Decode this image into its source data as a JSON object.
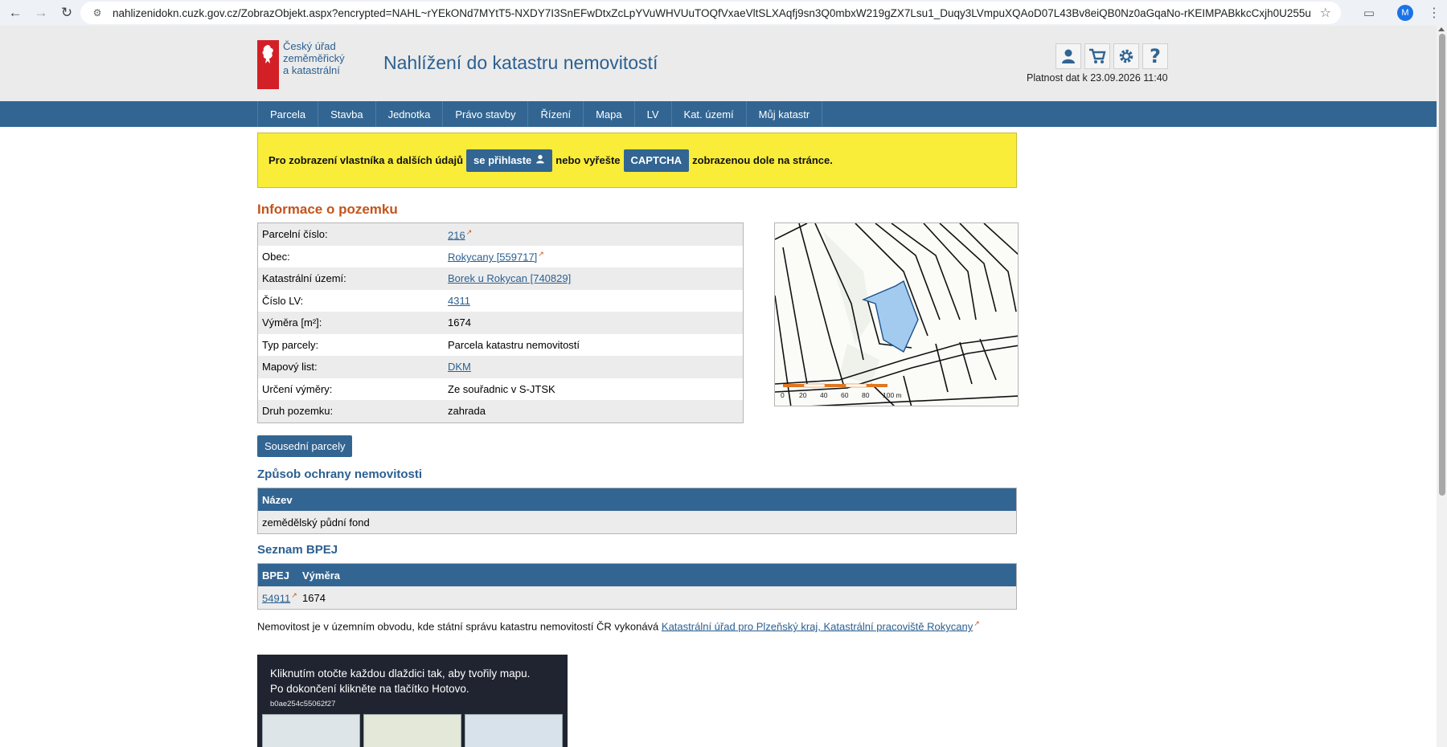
{
  "browser": {
    "url": "nahlizenidokn.cuzk.gov.cz/ZobrazObjekt.aspx?encrypted=NAHL~rYEkONd7MYtT5-NXDY7I3SnEFwDtxZcLpYVuWHVUuTOQfVxaeVltSLXAqfj9sn3Q0mbxW219gZX7Lsu1_Duqy3LVmpuXQAoD07L43Bv8eiQB0Nz0aGqaNo-rKEIMPABkkcCxjh0U255ugr2Bb4ZVx...",
    "profile_initial": "M"
  },
  "header": {
    "logo_lines": [
      "Český úřad",
      "zeměměřický",
      "a katastrální"
    ],
    "title": "Nahlížení do katastru nemovitostí",
    "validity": "Platnost dat k 23.09.2026 11:40"
  },
  "menu": [
    "Parcela",
    "Stavba",
    "Jednotka",
    "Právo stavby",
    "Řízení",
    "Mapa",
    "LV",
    "Kat. území",
    "Můj katastr"
  ],
  "notice": {
    "part1": "Pro zobrazení vlastníka a dalších údajů",
    "login_button": "se přihlaste",
    "part2": "nebo vyřešte",
    "captcha_button": "CAPTCHA",
    "part3": "zobrazenou dole na stránce."
  },
  "parcel": {
    "heading": "Informace o pozemku",
    "rows": [
      {
        "label": "Parcelní číslo:",
        "value": "216",
        "link": true,
        "ext": true
      },
      {
        "label": "Obec:",
        "value": "Rokycany [559717]",
        "link": true,
        "ext": true
      },
      {
        "label": "Katastrální území:",
        "value": "Borek u Rokycan [740829]",
        "link": true,
        "ext": false
      },
      {
        "label": "Číslo LV:",
        "value": "4311",
        "link": true,
        "ext": false
      },
      {
        "label": "Výměra [m²]:",
        "value": "1674",
        "link": false,
        "ext": false
      },
      {
        "label": "Typ parcely:",
        "value": "Parcela katastru nemovitostí",
        "link": false,
        "ext": false
      },
      {
        "label": "Mapový list:",
        "value": "DKM",
        "link": true,
        "ext": false
      },
      {
        "label": "Určení výměry:",
        "value": "Ze souřadnic v S-JTSK",
        "link": false,
        "ext": false
      },
      {
        "label": "Druh pozemku:",
        "value": "zahrada",
        "link": false,
        "ext": false
      }
    ],
    "neighbors_button": "Sousední parcely",
    "map_scale_labels": [
      "0",
      "20",
      "40",
      "60",
      "80",
      "100 m"
    ]
  },
  "protection": {
    "heading": "Způsob ochrany nemovitosti",
    "column": "Název",
    "value": "zemědělský půdní fond"
  },
  "bpej": {
    "heading": "Seznam BPEJ",
    "columns": [
      "BPEJ",
      "Výměra"
    ],
    "code": "54911",
    "area": "1674"
  },
  "authority": {
    "text": "Nemovitost je v územním obvodu, kde státní správu katastru nemovitostí ČR vykonává",
    "link": "Katastrální úřad pro Plzeňský kraj, Katastrální pracoviště Rokycany"
  },
  "captcha": {
    "instruction": "Kliknutím otočte každou dlaždici tak, aby tvořily mapu. Po dokončení klikněte na tlačítko Hotovo.",
    "id": "b0ae254c55062f27"
  },
  "colors": {
    "brand_blue": "#326592",
    "notice_yellow": "#f9ed3a",
    "heading_orange": "#c3541c",
    "parcel_fill": "#a3cbf0"
  }
}
